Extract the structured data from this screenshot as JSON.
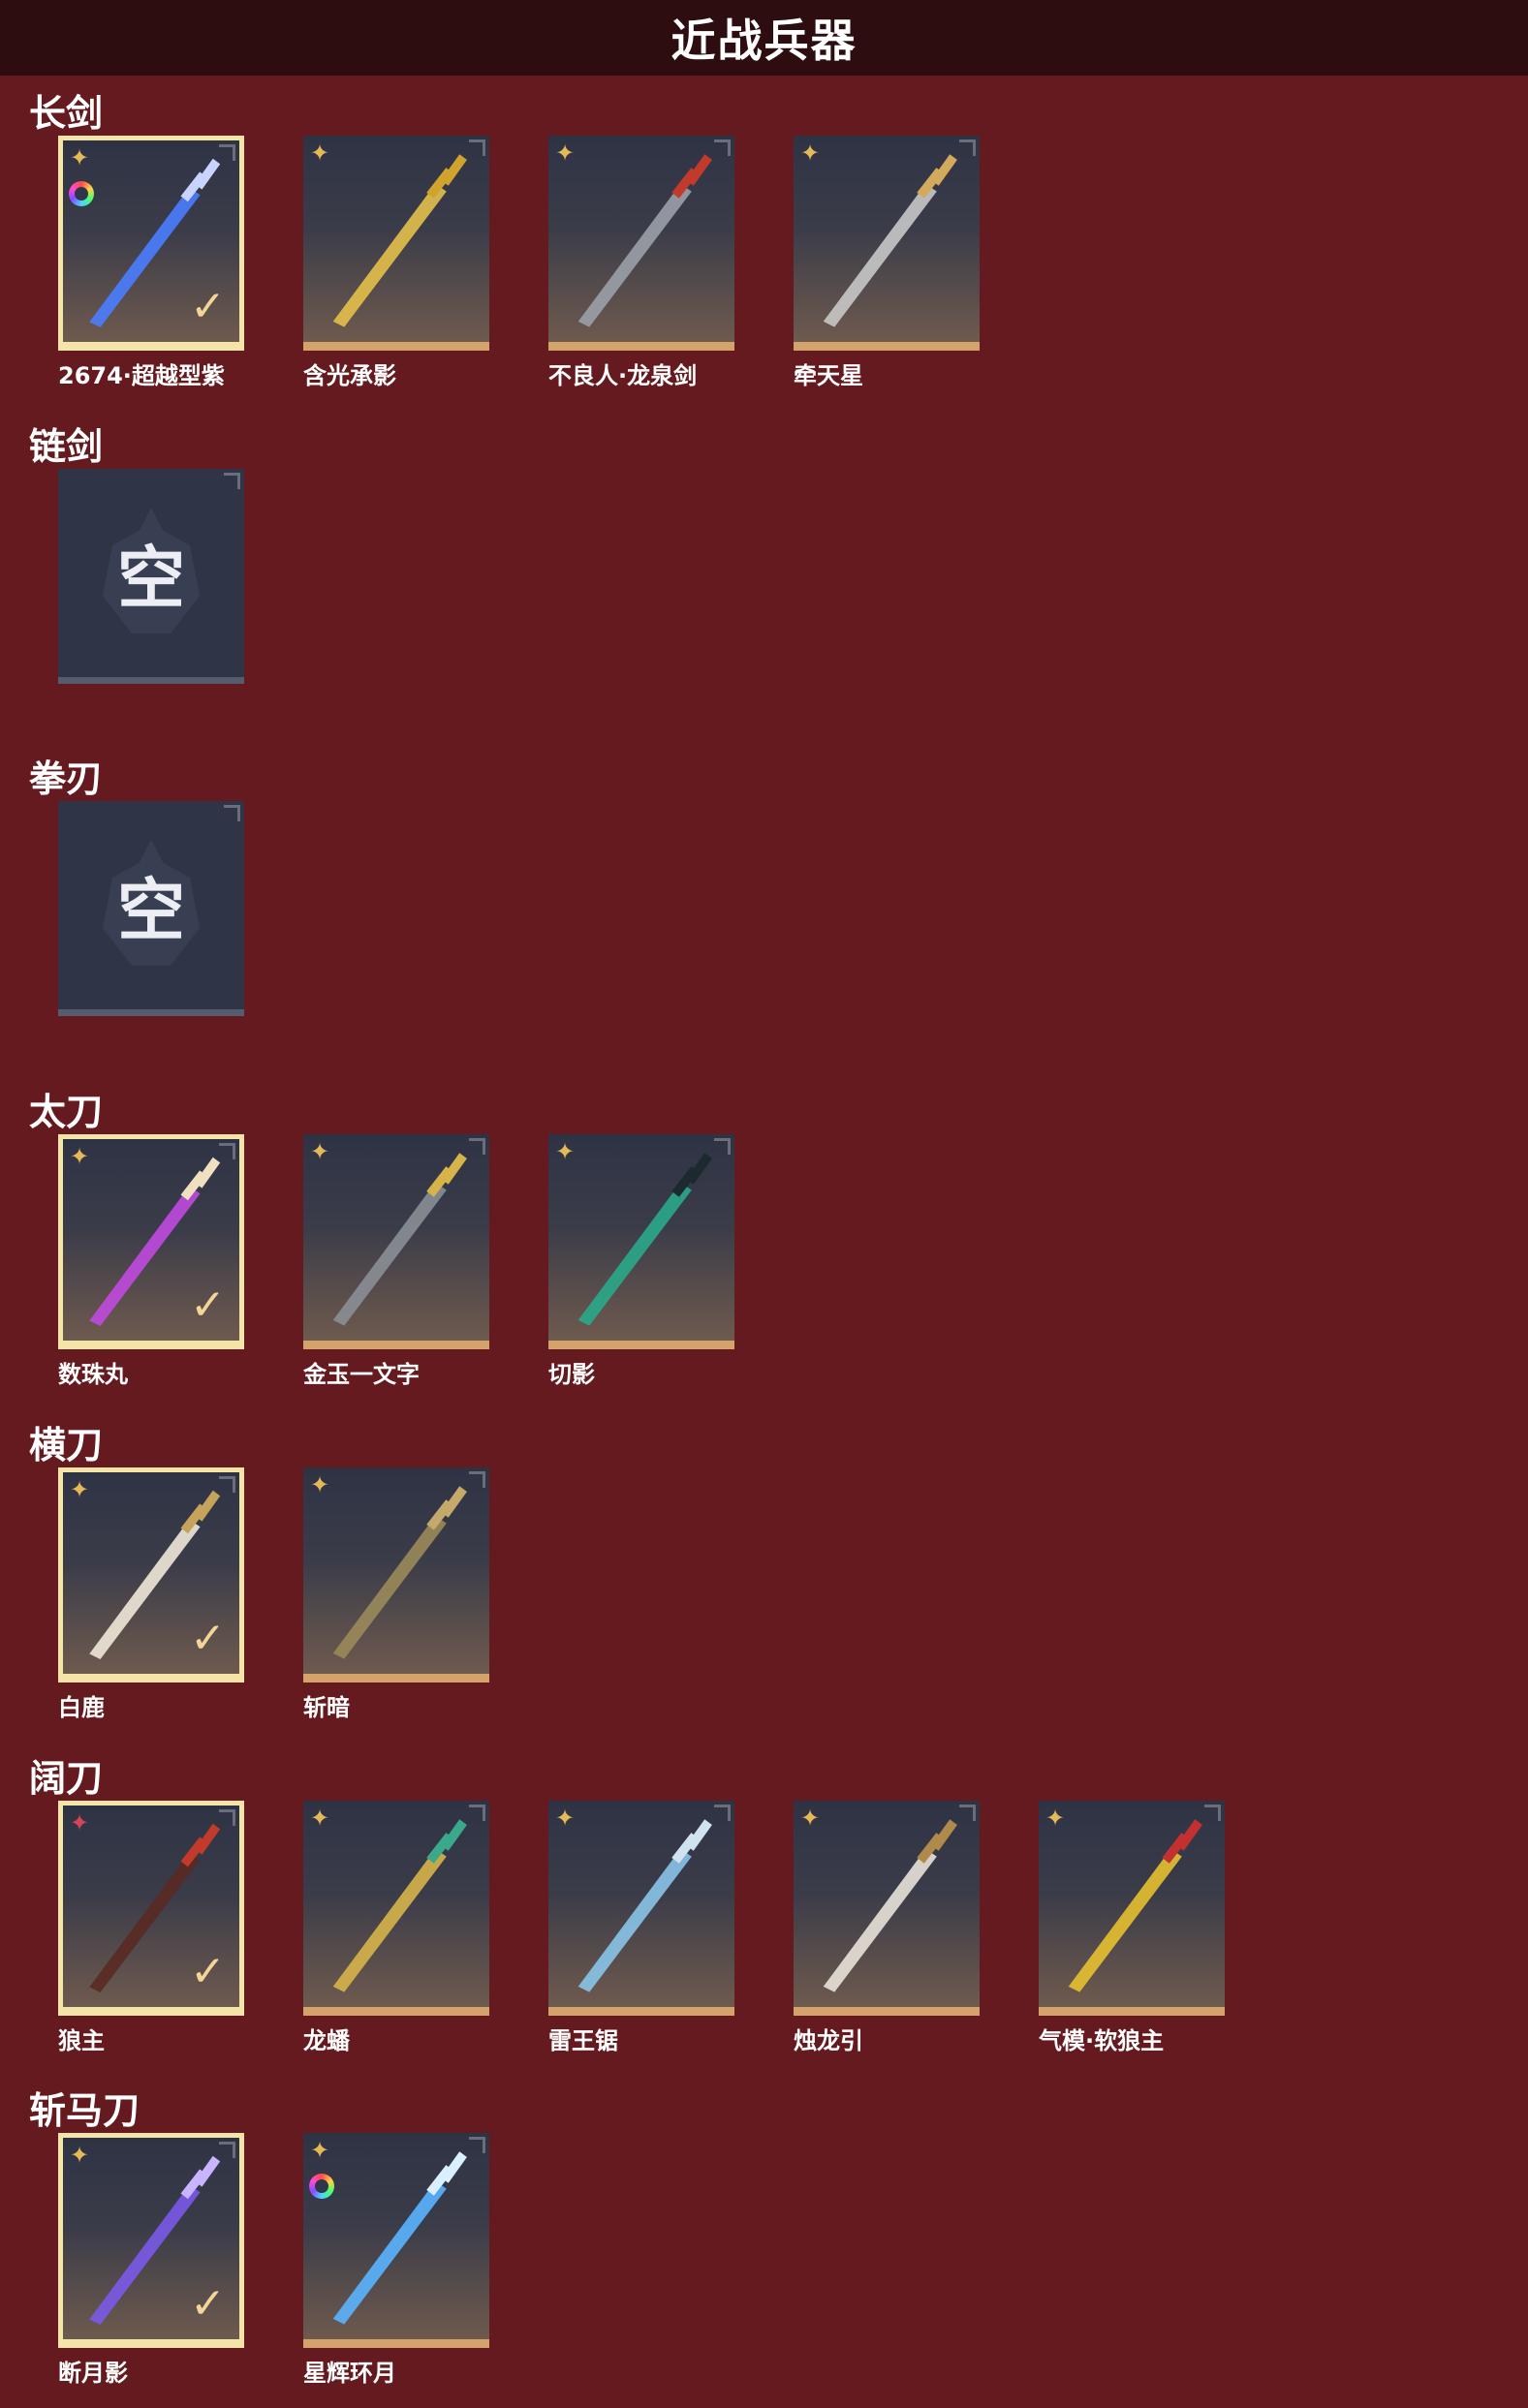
{
  "header": {
    "title": "近战兵器"
  },
  "colors": {
    "background": "#651a1f",
    "header": "#2e0d10",
    "rarity_gold": "#e5b955",
    "rarity_red": "#d64454",
    "selected_border": "#f5e4a8"
  },
  "sections": [
    {
      "title": "长剑",
      "items": [
        {
          "label": "2674·超越型紫",
          "selected": true,
          "rarity": "gold",
          "ring": true,
          "blade": "#4a7dff",
          "hilt": "#c8d4ff"
        },
        {
          "label": "含光承影",
          "selected": false,
          "rarity": "gold",
          "blade": "#e3c04a",
          "hilt": "#d1a22c"
        },
        {
          "label": "不良人·龙泉剑",
          "selected": false,
          "rarity": "gold",
          "blade": "#9aa0a8",
          "hilt": "#c23a2a"
        },
        {
          "label": "牵天星",
          "selected": false,
          "rarity": "gold",
          "blade": "#c8c8c8",
          "hilt": "#d3a95c"
        }
      ]
    },
    {
      "title": "链剑",
      "items": [
        {
          "label": "",
          "empty": true,
          "empty_text": "空"
        }
      ]
    },
    {
      "title": "拳刃",
      "items": [
        {
          "label": "",
          "empty": true,
          "empty_text": "空"
        }
      ]
    },
    {
      "title": "太刀",
      "items": [
        {
          "label": "数珠丸",
          "selected": true,
          "rarity": "gold",
          "blade": "#c04adf",
          "hilt": "#f0e0c0"
        },
        {
          "label": "金玉一文字",
          "selected": false,
          "rarity": "gold",
          "blade": "#8a8f96",
          "hilt": "#d6b44a"
        },
        {
          "label": "切影",
          "selected": false,
          "rarity": "gold",
          "blade": "#2aa88a",
          "hilt": "#1c2a30"
        }
      ]
    },
    {
      "title": "横刀",
      "items": [
        {
          "label": "白鹿",
          "selected": true,
          "rarity": "gold",
          "blade": "#efe8d8",
          "hilt": "#c7a25a"
        },
        {
          "label": "斩暗",
          "selected": false,
          "rarity": "gold",
          "blade": "#9a8a5a",
          "hilt": "#c4a96a"
        }
      ]
    },
    {
      "title": "阔刀",
      "items": [
        {
          "label": "狼主",
          "selected": true,
          "rarity": "red",
          "blade": "#5a2a22",
          "hilt": "#c23a2a"
        },
        {
          "label": "龙蟠",
          "selected": false,
          "rarity": "gold",
          "blade": "#d6b44a",
          "hilt": "#3aa88a"
        },
        {
          "label": "雷王锯",
          "selected": false,
          "rarity": "gold",
          "blade": "#8ac4e8",
          "hilt": "#cfe4f0"
        },
        {
          "label": "烛龙引",
          "selected": false,
          "rarity": "gold",
          "blade": "#e8e2d8",
          "hilt": "#b08a4a"
        },
        {
          "label": "气模·软狼主",
          "selected": false,
          "rarity": "gold",
          "blade": "#e6c030",
          "hilt": "#c23030"
        }
      ]
    },
    {
      "title": "斩马刀",
      "items": [
        {
          "label": "断月影",
          "selected": true,
          "rarity": "gold",
          "blade": "#7a5ae8",
          "hilt": "#c8b4ff"
        },
        {
          "label": "星辉环月",
          "selected": false,
          "rarity": "gold",
          "ring": true,
          "blade": "#5ab4ff",
          "hilt": "#d8f0ff"
        }
      ]
    }
  ],
  "icons": {
    "rarity_mark": "four-point-star-icon",
    "equipped_mark": "check-icon",
    "frame_corner": "corner-bracket-icon"
  }
}
